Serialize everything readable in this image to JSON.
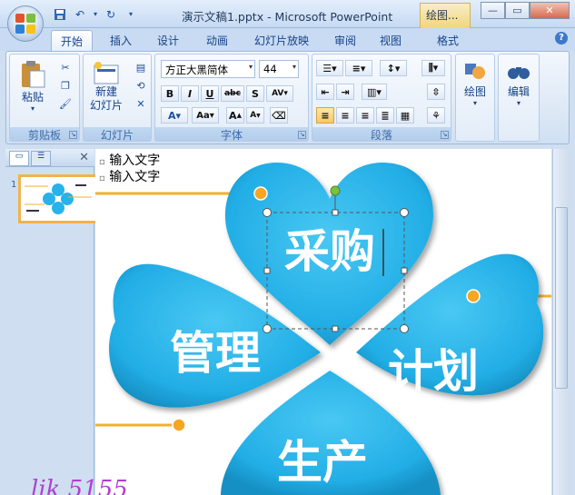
{
  "window": {
    "title": "演示文稿1.pptx - Microsoft PowerPoint",
    "context_tab": "绘图..."
  },
  "tabs": [
    "开始",
    "插入",
    "设计",
    "动画",
    "幻灯片放映",
    "审阅",
    "视图",
    "格式"
  ],
  "ribbon": {
    "clipboard": {
      "label": "剪贴板",
      "paste": "粘贴"
    },
    "slides": {
      "label": "幻灯片",
      "new_slide": "新建\n幻灯片"
    },
    "font": {
      "label": "字体",
      "font_name": "方正大黑简体",
      "font_size": "44"
    },
    "paragraph": {
      "label": "段落"
    },
    "drawing": {
      "label": "绘图"
    },
    "editing": {
      "label": "编辑"
    }
  },
  "slide_panel": {
    "thumb_number": "1"
  },
  "slide": {
    "text_lines": [
      "输入文字",
      "输入文字"
    ],
    "petals": [
      "采购",
      "管理",
      "计划",
      "生产"
    ]
  },
  "overlay": {
    "handwriting": "lik 5155"
  },
  "colors": {
    "petal": "#27b2ea",
    "connector": "#f0b030",
    "selection": "#555555"
  }
}
